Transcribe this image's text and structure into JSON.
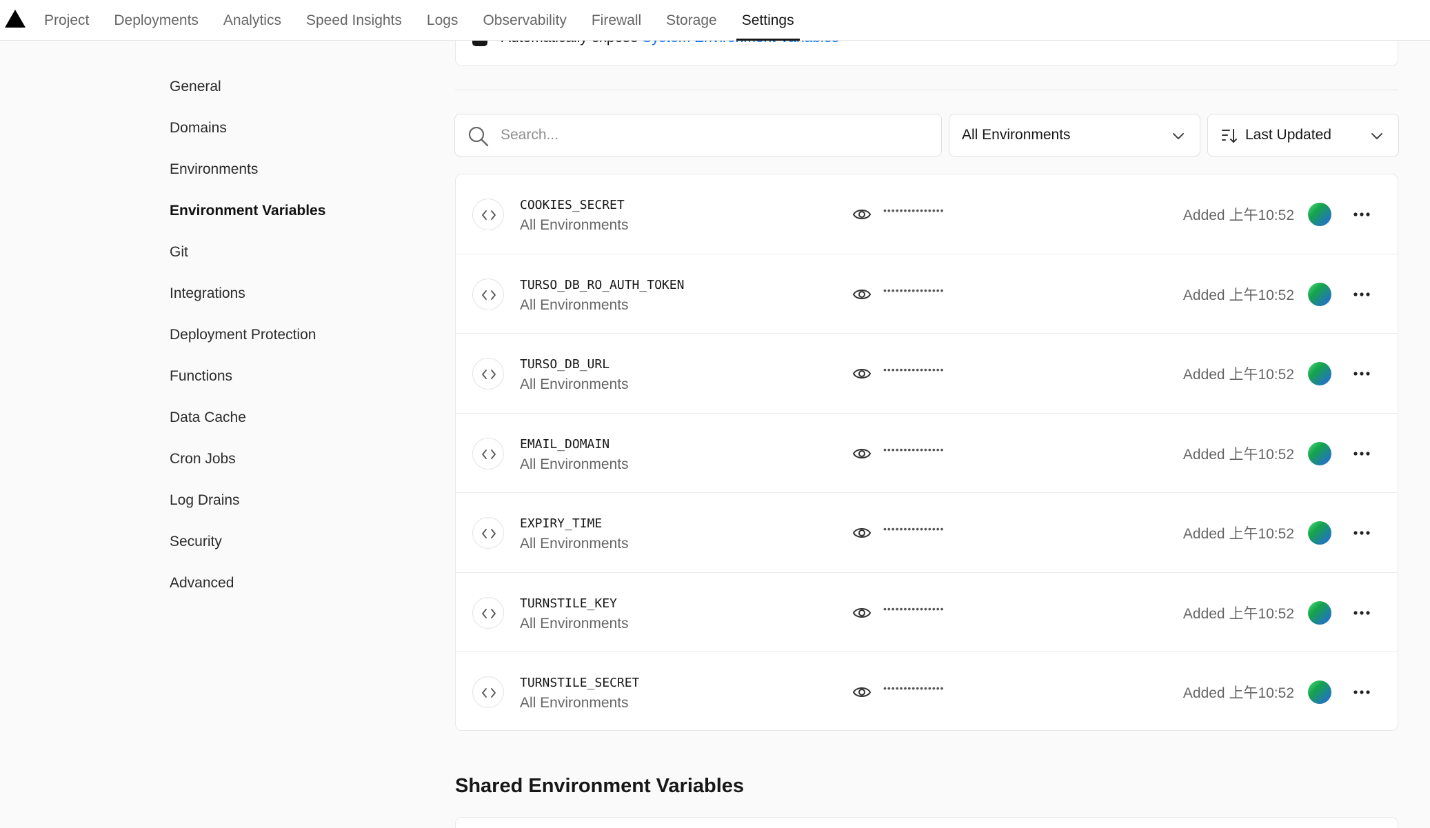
{
  "nav": {
    "tabs": [
      {
        "label": "Project"
      },
      {
        "label": "Deployments"
      },
      {
        "label": "Analytics"
      },
      {
        "label": "Speed Insights"
      },
      {
        "label": "Logs"
      },
      {
        "label": "Observability"
      },
      {
        "label": "Firewall"
      },
      {
        "label": "Storage"
      },
      {
        "label": "Settings",
        "active": true
      }
    ]
  },
  "sidebar": {
    "items": [
      {
        "label": "General"
      },
      {
        "label": "Domains"
      },
      {
        "label": "Environments"
      },
      {
        "label": "Environment Variables",
        "active": true
      },
      {
        "label": "Git"
      },
      {
        "label": "Integrations"
      },
      {
        "label": "Deployment Protection"
      },
      {
        "label": "Functions"
      },
      {
        "label": "Data Cache"
      },
      {
        "label": "Cron Jobs"
      },
      {
        "label": "Log Drains"
      },
      {
        "label": "Security"
      },
      {
        "label": "Advanced"
      }
    ]
  },
  "system_env": {
    "text": "Automatically expose ",
    "link": "System Environment Variables",
    "checked": true
  },
  "filters": {
    "search_placeholder": "Search...",
    "environment": "All Environments",
    "sort": "Last Updated"
  },
  "variables": [
    {
      "name": "COOKIES_SECRET",
      "env": "All Environments",
      "masked": "•••••••••••••••",
      "added": "Added 上午10:52"
    },
    {
      "name": "TURSO_DB_RO_AUTH_TOKEN",
      "env": "All Environments",
      "masked": "•••••••••••••••",
      "added": "Added 上午10:52"
    },
    {
      "name": "TURSO_DB_URL",
      "env": "All Environments",
      "masked": "•••••••••••••••",
      "added": "Added 上午10:52"
    },
    {
      "name": "EMAIL_DOMAIN",
      "env": "All Environments",
      "masked": "•••••••••••••••",
      "added": "Added 上午10:52"
    },
    {
      "name": "EXPIRY_TIME",
      "env": "All Environments",
      "masked": "•••••••••••••••",
      "added": "Added 上午10:52"
    },
    {
      "name": "TURNSTILE_KEY",
      "env": "All Environments",
      "masked": "•••••••••••••••",
      "added": "Added 上午10:52"
    },
    {
      "name": "TURNSTILE_SECRET",
      "env": "All Environments",
      "masked": "•••••••••••••••",
      "added": "Added 上午10:52"
    }
  ],
  "shared": {
    "title": "Shared Environment Variables"
  },
  "icons": {
    "logo": "vercel-triangle-icon",
    "search": "search-icon",
    "chevron": "chevron-down-icon",
    "sort": "sort-icon",
    "code": "code-brackets-icon",
    "eye": "eye-icon",
    "more": "more-horizontal-icon"
  },
  "colors": {
    "accent_link": "#0070f3",
    "text_primary": "#171717",
    "text_secondary": "#666666",
    "background": "#fafafa"
  }
}
